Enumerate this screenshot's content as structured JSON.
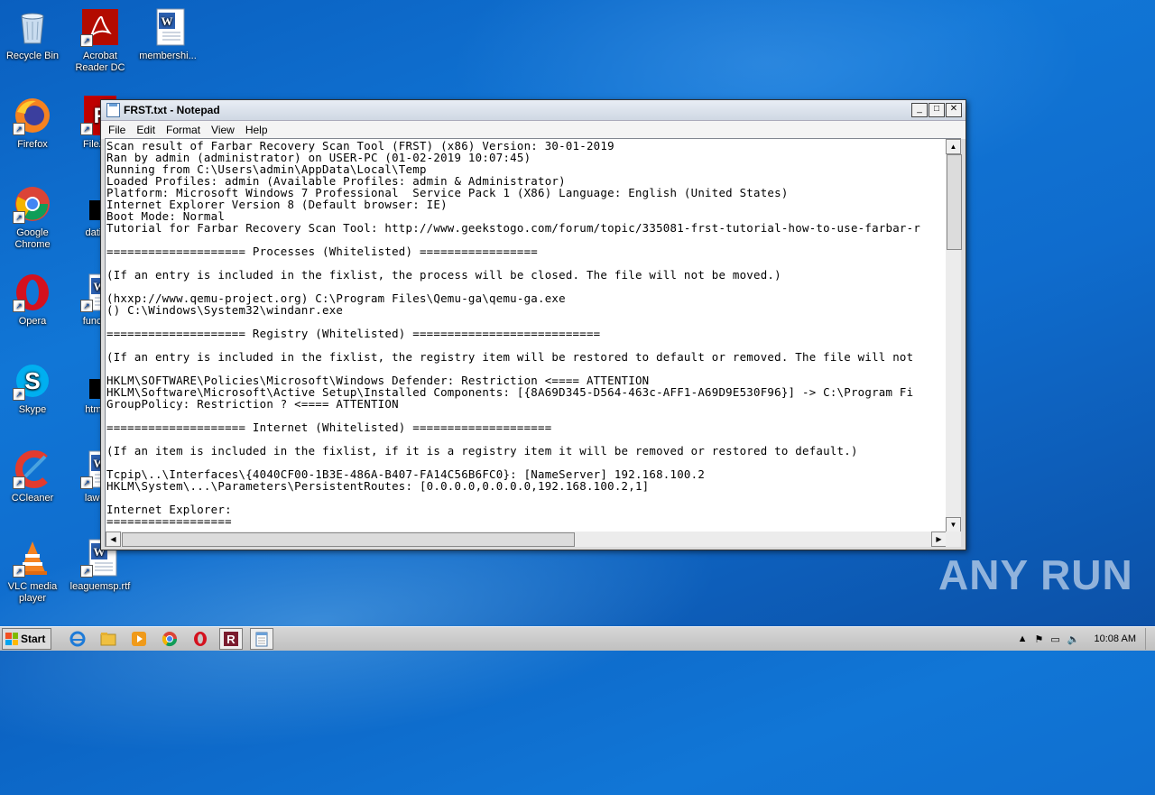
{
  "desktop": {
    "icons": [
      {
        "label": "Recycle Bin"
      },
      {
        "label": "Acrobat Reader DC"
      },
      {
        "label": "membershi..."
      },
      {
        "label": "Firefox"
      },
      {
        "label": "FileZilla"
      },
      {
        "label": "Google Chrome"
      },
      {
        "label": "datingf"
      },
      {
        "label": "Opera"
      },
      {
        "label": "function"
      },
      {
        "label": "Skype"
      },
      {
        "label": "htmlfar"
      },
      {
        "label": "CCleaner"
      },
      {
        "label": "lawcha"
      },
      {
        "label": "VLC media player"
      },
      {
        "label": "leaguemsp.rtf"
      }
    ],
    "watermark": "ANY RUN"
  },
  "notepad": {
    "title": "FRST.txt - Notepad",
    "menu": [
      "File",
      "Edit",
      "Format",
      "View",
      "Help"
    ],
    "content": "Scan result of Farbar Recovery Scan Tool (FRST) (x86) Version: 30-01-2019\nRan by admin (administrator) on USER-PC (01-02-2019 10:07:45)\nRunning from C:\\Users\\admin\\AppData\\Local\\Temp\nLoaded Profiles: admin (Available Profiles: admin & Administrator)\nPlatform: Microsoft Windows 7 Professional  Service Pack 1 (X86) Language: English (United States)\nInternet Explorer Version 8 (Default browser: IE)\nBoot Mode: Normal\nTutorial for Farbar Recovery Scan Tool: http://www.geekstogo.com/forum/topic/335081-frst-tutorial-how-to-use-farbar-r\n\n==================== Processes (Whitelisted) =================\n\n(If an entry is included in the fixlist, the process will be closed. The file will not be moved.)\n\n(hxxp://www.qemu-project.org) C:\\Program Files\\Qemu-ga\\qemu-ga.exe\n() C:\\Windows\\System32\\windanr.exe\n\n==================== Registry (Whitelisted) ===========================\n\n(If an entry is included in the fixlist, the registry item will be restored to default or removed. The file will not\n\nHKLM\\SOFTWARE\\Policies\\Microsoft\\Windows Defender: Restriction <==== ATTENTION\nHKLM\\Software\\Microsoft\\Active Setup\\Installed Components: [{8A69D345-D564-463c-AFF1-A69D9E530F96}] -> C:\\Program Fi\nGroupPolicy: Restriction ? <==== ATTENTION\n\n==================== Internet (Whitelisted) ====================\n\n(If an item is included in the fixlist, if it is a registry item it will be removed or restored to default.)\n\nTcpip\\..\\Interfaces\\{4040CF00-1B3E-486A-B407-FA14C56B6FC0}: [NameServer] 192.168.100.2\nHKLM\\System\\...\\Parameters\\PersistentRoutes: [0.0.0.0,0.0.0.0,192.168.100.2,1]\n\nInternet Explorer:\n=================="
  },
  "taskbar": {
    "start_label": "Start",
    "clock": "10:08 AM"
  }
}
